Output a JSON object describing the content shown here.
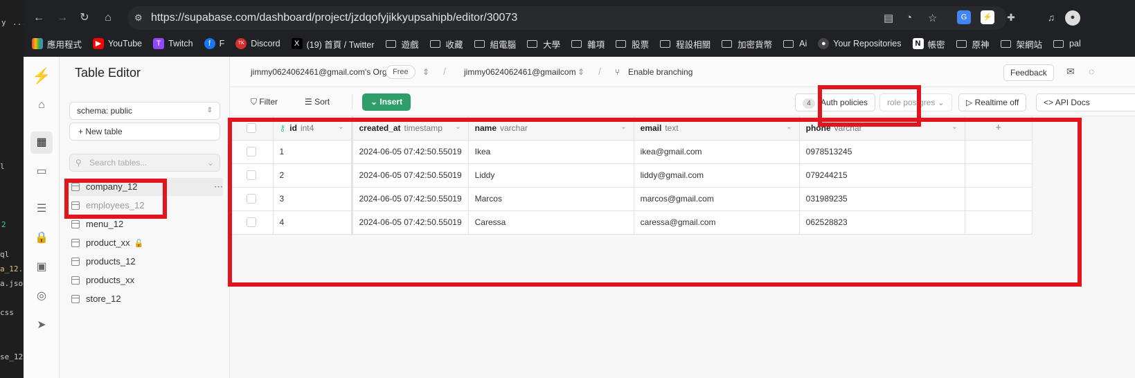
{
  "background_window": {
    "lines": [
      "y",
      "...",
      "l",
      "2",
      "ql",
      "a_12.js",
      "a.json",
      "css",
      "se_12."
    ]
  },
  "browser": {
    "url": "https://supabase.com/dashboard/project/jzdqofyjikkyupsahipb/editor/30073",
    "bookmarks": [
      {
        "label": "應用程式",
        "icon": "apps-grid-icon"
      },
      {
        "label": "YouTube",
        "icon": "youtube-icon"
      },
      {
        "label": "Twitch",
        "icon": "twitch-icon"
      },
      {
        "label": "F",
        "icon": "facebook-icon"
      },
      {
        "label": "Discord",
        "icon": "tick-icon"
      },
      {
        "label": "(19) 首頁 / Twitter",
        "icon": "x-icon"
      },
      {
        "label": "遊戲",
        "icon": "folder-icon"
      },
      {
        "label": "收藏",
        "icon": "folder-icon"
      },
      {
        "label": "組電腦",
        "icon": "folder-icon"
      },
      {
        "label": "大學",
        "icon": "folder-icon"
      },
      {
        "label": "雜項",
        "icon": "folder-icon"
      },
      {
        "label": "股票",
        "icon": "folder-icon"
      },
      {
        "label": "程設相關",
        "icon": "folder-icon"
      },
      {
        "label": "加密貨幣",
        "icon": "folder-icon"
      },
      {
        "label": "Ai",
        "icon": "folder-icon"
      },
      {
        "label": "Your Repositories",
        "icon": "github-icon"
      },
      {
        "label": "帳密",
        "icon": "notion-icon"
      },
      {
        "label": "原神",
        "icon": "folder-icon"
      },
      {
        "label": "架網站",
        "icon": "folder-icon"
      },
      {
        "label": "pal",
        "icon": "folder-icon"
      }
    ]
  },
  "sidebar": {
    "title": "Table Editor",
    "schema_label": "schema: public",
    "new_table_label": "New table",
    "search_placeholder": "Search tables...",
    "tables": [
      {
        "name": "company_12",
        "selected": true,
        "locked": false
      },
      {
        "name": "employees_12",
        "selected": false,
        "locked": false
      },
      {
        "name": "menu_12",
        "selected": false,
        "locked": false
      },
      {
        "name": "product_xx",
        "selected": false,
        "locked": true
      },
      {
        "name": "products_12",
        "selected": false,
        "locked": false
      },
      {
        "name": "products_xx",
        "selected": false,
        "locked": false
      },
      {
        "name": "store_12",
        "selected": false,
        "locked": false
      }
    ]
  },
  "header": {
    "org": "jimmy0624062461@gmail.com's Org",
    "plan": "Free",
    "project": "jimmy0624062461@gmailcom",
    "branching": "Enable branching",
    "feedback": "Feedback"
  },
  "toolbar": {
    "filter": "Filter",
    "sort": "Sort",
    "insert": "Insert",
    "auth_count": "4",
    "auth_policies": "Auth policies",
    "role": "role postgres",
    "realtime": "Realtime off",
    "api_docs": "API Docs"
  },
  "table": {
    "columns": [
      {
        "name": "id",
        "type": "int4",
        "key": true
      },
      {
        "name": "created_at",
        "type": "timestamp",
        "key": false
      },
      {
        "name": "name",
        "type": "varchar",
        "key": false
      },
      {
        "name": "email",
        "type": "text",
        "key": false
      },
      {
        "name": "phone",
        "type": "varchar",
        "key": false
      }
    ],
    "add_column": "+",
    "rows": [
      [
        "1",
        "2024-06-05 07:42:50.55019",
        "Ikea",
        "ikea@gmail.com",
        "0978513245"
      ],
      [
        "2",
        "2024-06-05 07:42:50.55019",
        "Liddy",
        "liddy@gmail.com",
        "079244215"
      ],
      [
        "3",
        "2024-06-05 07:42:50.55019",
        "Marcos",
        "marcos@gmail.com",
        "031989235"
      ],
      [
        "4",
        "2024-06-05 07:42:50.55019",
        "Caressa",
        "caressa@gmail.com",
        "062528823"
      ]
    ]
  },
  "highlight_color": "#e3141e",
  "accent_color": "#2e9e6a"
}
